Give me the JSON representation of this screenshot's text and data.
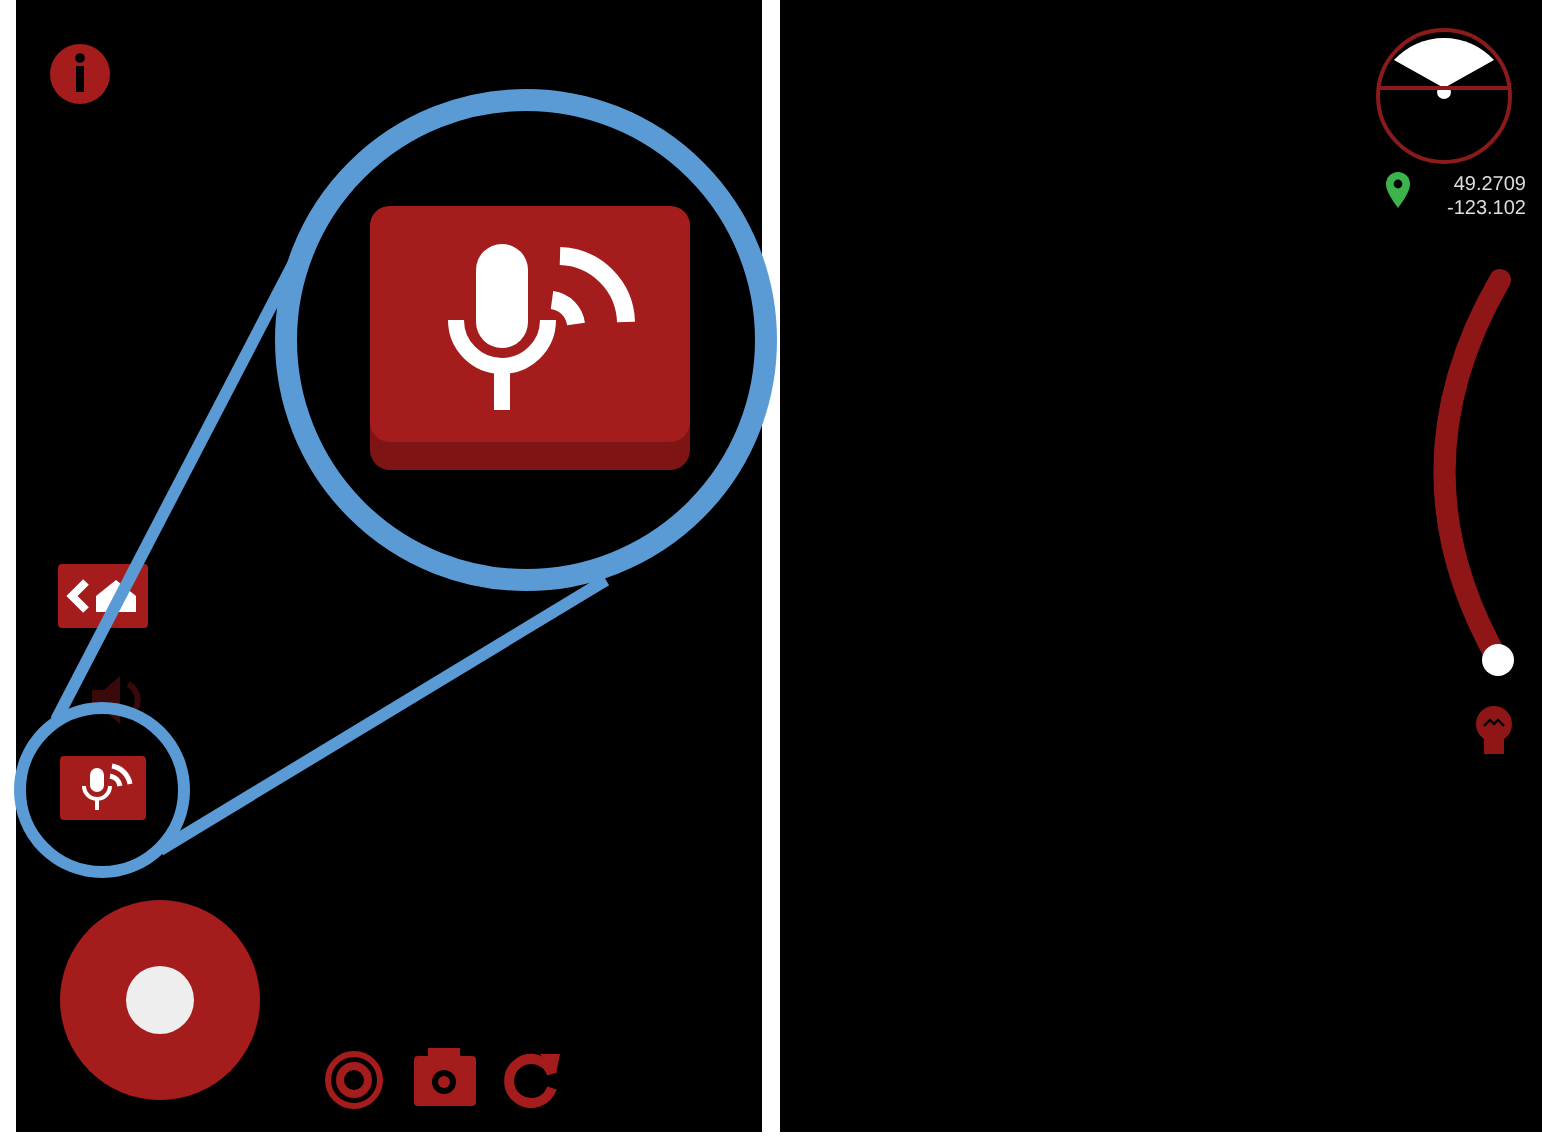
{
  "left_view": {
    "sound": {
      "on": false
    }
  },
  "right_view": {
    "location": {
      "latitude": "49.2709",
      "longitude": "-123.102"
    },
    "zoom_slider": {
      "level": 0
    }
  }
}
